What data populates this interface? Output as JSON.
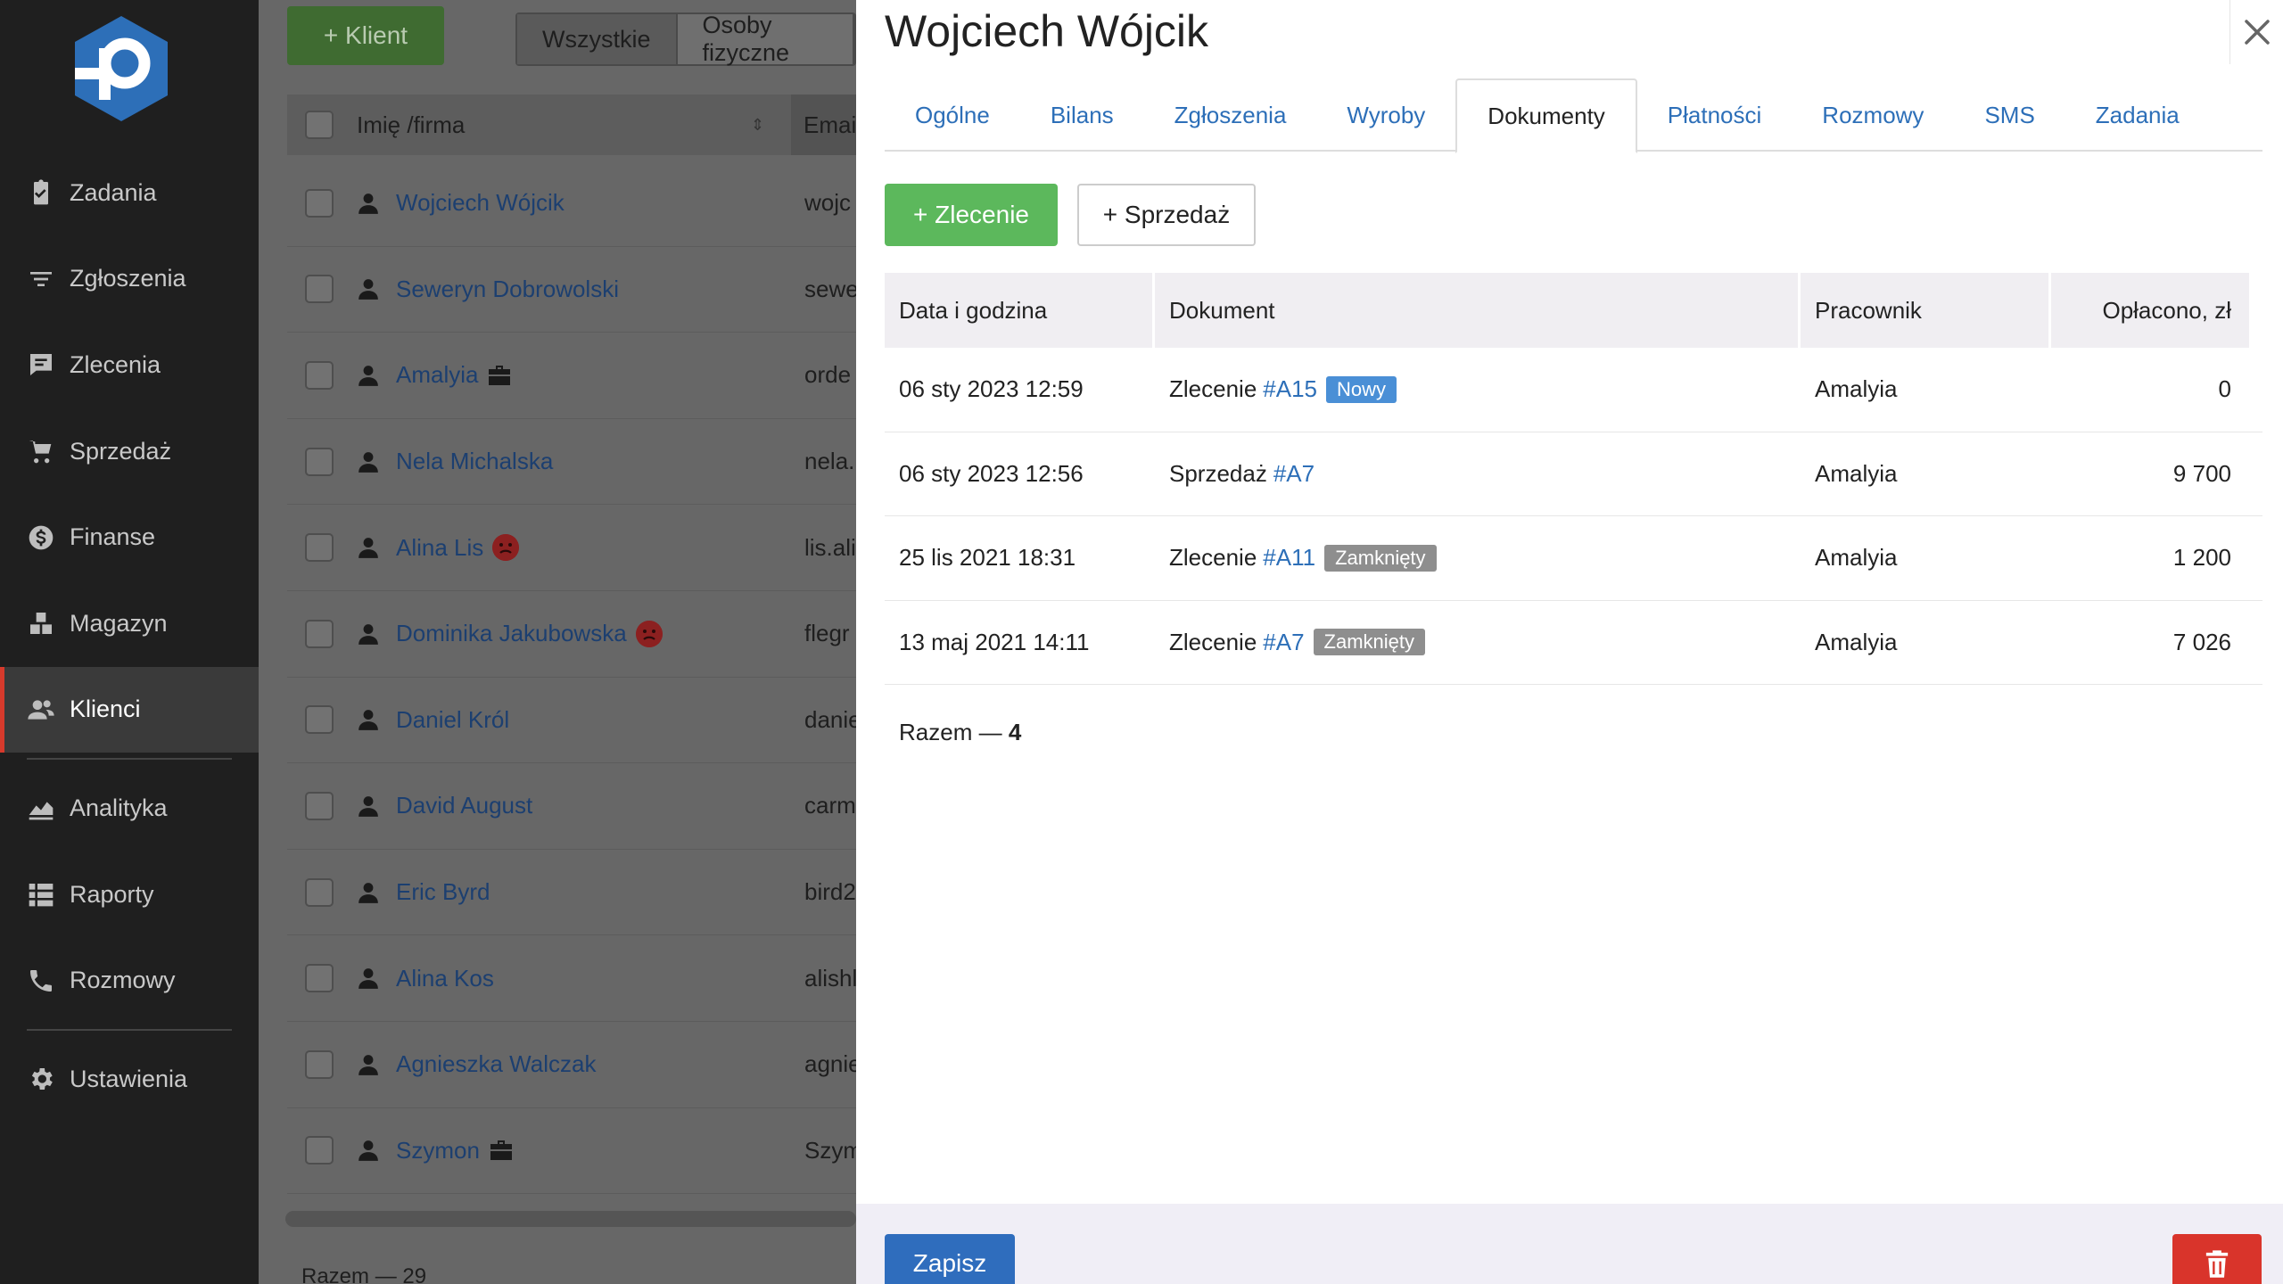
{
  "sidebar": {
    "items": [
      {
        "label": "Zadania",
        "icon": "clipboard-check-icon"
      },
      {
        "label": "Zgłoszenia",
        "icon": "filter-icon"
      },
      {
        "label": "Zlecenia",
        "icon": "order-icon"
      },
      {
        "label": "Sprzedaż",
        "icon": "cart-icon"
      },
      {
        "label": "Finanse",
        "icon": "dollar-coin-icon"
      },
      {
        "label": "Magazyn",
        "icon": "warehouse-icon"
      },
      {
        "label": "Klienci",
        "icon": "users-icon",
        "active": true
      },
      {
        "label": "Analityka",
        "icon": "chart-area-icon"
      },
      {
        "label": "Raporty",
        "icon": "report-list-icon"
      },
      {
        "label": "Rozmowy",
        "icon": "phone-icon"
      },
      {
        "label": "Ustawienia",
        "icon": "gear-icon"
      }
    ]
  },
  "list": {
    "add_label": "+ Klient",
    "filters": [
      "Wszystkie",
      "Osoby fizyczne"
    ],
    "col_name": "Imię /firma",
    "col_email": "Emai",
    "rows": [
      {
        "name": "Wojciech Wójcik",
        "email": "wojc",
        "mark": ""
      },
      {
        "name": "Seweryn Dobrowolski",
        "email": "sewe",
        "mark": ""
      },
      {
        "name": "Amalyia",
        "email": "orde",
        "mark": "company"
      },
      {
        "name": "Nela Michalska",
        "email": "nela.",
        "mark": ""
      },
      {
        "name": "Alina Lis",
        "email": "lis.ali",
        "mark": "sad"
      },
      {
        "name": "Dominika Jakubowska",
        "email": "flegr",
        "mark": "sad"
      },
      {
        "name": "Daniel Król",
        "email": "danie",
        "mark": ""
      },
      {
        "name": "David August",
        "email": "carm",
        "mark": ""
      },
      {
        "name": "Eric Byrd",
        "email": "bird2",
        "mark": ""
      },
      {
        "name": "Alina Kos",
        "email": "alishl",
        "mark": ""
      },
      {
        "name": "Agnieszka Walczak",
        "email": "agnie",
        "mark": ""
      },
      {
        "name": "Szymon",
        "email": "Szym",
        "mark": "company"
      }
    ],
    "total": "Razem — 29"
  },
  "panel": {
    "title": "Wojciech Wójcik",
    "tabs": [
      "Ogólne",
      "Bilans",
      "Zgłoszenia",
      "Wyroby",
      "Dokumenty",
      "Płatności",
      "Rozmowy",
      "SMS",
      "Zadania"
    ],
    "active_tab": "Dokumenty",
    "btn_zlecenie": "+ Zlecenie",
    "btn_sprzedaz": "+ Sprzedaż",
    "table": {
      "headers": [
        "Data i godzina",
        "Dokument",
        "Pracownik",
        "Opłacono, zł"
      ],
      "rows": [
        {
          "date": "06 sty 2023 12:59",
          "doc_type": "Zlecenie",
          "doc_no": "#A15",
          "status": "Nowy",
          "status_kind": "new",
          "employee": "Amalyia",
          "paid": "0"
        },
        {
          "date": "06 sty 2023 12:56",
          "doc_type": "Sprzedaż",
          "doc_no": "#A7",
          "status": "",
          "status_kind": "",
          "employee": "Amalyia",
          "paid": "9 700"
        },
        {
          "date": "25 lis 2021 18:31",
          "doc_type": "Zlecenie",
          "doc_no": "#A11",
          "status": "Zamknięty",
          "status_kind": "closed",
          "employee": "Amalyia",
          "paid": "1 200"
        },
        {
          "date": "13 maj 2021 14:11",
          "doc_type": "Zlecenie",
          "doc_no": "#A7",
          "status": "Zamknięty",
          "status_kind": "closed",
          "employee": "Amalyia",
          "paid": "7 026"
        }
      ]
    },
    "total_label": "Razem — ",
    "total_count": "4",
    "save_label": "Zapisz"
  },
  "colors": {
    "accent_green": "#5cb85c",
    "link_blue": "#2d6fb8",
    "save_blue": "#2f6dbd",
    "delete_red": "#d9342b",
    "badge_new": "#4a8fd6",
    "badge_closed": "#8e8e8e"
  }
}
